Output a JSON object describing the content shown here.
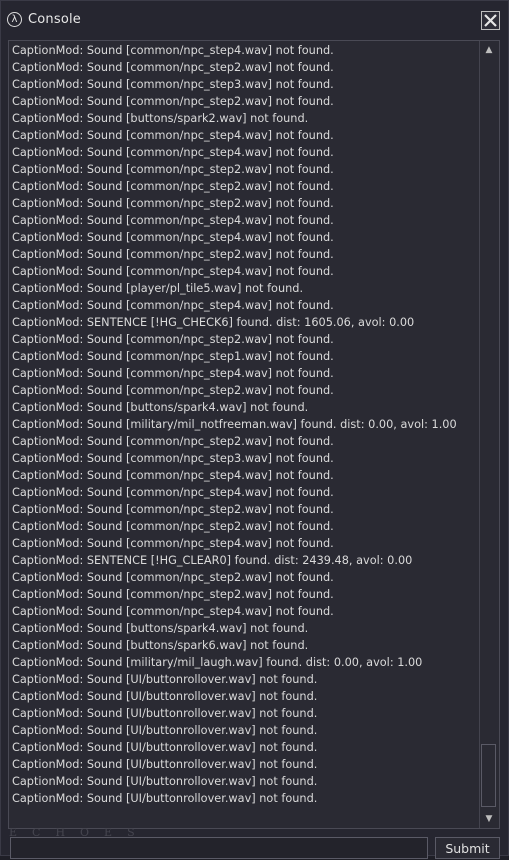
{
  "window": {
    "title": "Console",
    "icon": "lambda-icon",
    "icon_glyph": "λ",
    "close_icon": "close-icon"
  },
  "log": {
    "lines": [
      "CaptionMod: Sound [common/npc_step4.wav] not found.",
      "CaptionMod: Sound [common/npc_step2.wav] not found.",
      "CaptionMod: Sound [common/npc_step3.wav] not found.",
      "CaptionMod: Sound [common/npc_step2.wav] not found.",
      "CaptionMod: Sound [buttons/spark2.wav] not found.",
      "CaptionMod: Sound [common/npc_step4.wav] not found.",
      "CaptionMod: Sound [common/npc_step4.wav] not found.",
      "CaptionMod: Sound [common/npc_step2.wav] not found.",
      "CaptionMod: Sound [common/npc_step2.wav] not found.",
      "CaptionMod: Sound [common/npc_step2.wav] not found.",
      "CaptionMod: Sound [common/npc_step4.wav] not found.",
      "CaptionMod: Sound [common/npc_step4.wav] not found.",
      "CaptionMod: Sound [common/npc_step2.wav] not found.",
      "CaptionMod: Sound [common/npc_step4.wav] not found.",
      "CaptionMod: Sound [player/pl_tile5.wav] not found.",
      "CaptionMod: Sound [common/npc_step4.wav] not found.",
      "CaptionMod: SENTENCE [!HG_CHECK6] found. dist: 1605.06, avol: 0.00",
      "CaptionMod: Sound [common/npc_step2.wav] not found.",
      "CaptionMod: Sound [common/npc_step1.wav] not found.",
      "CaptionMod: Sound [common/npc_step4.wav] not found.",
      "CaptionMod: Sound [common/npc_step2.wav] not found.",
      "CaptionMod: Sound [buttons/spark4.wav] not found.",
      "CaptionMod: Sound [military/mil_notfreeman.wav] found. dist: 0.00, avol: 1.00",
      "CaptionMod: Sound [common/npc_step2.wav] not found.",
      "CaptionMod: Sound [common/npc_step3.wav] not found.",
      "CaptionMod: Sound [common/npc_step4.wav] not found.",
      "CaptionMod: Sound [common/npc_step4.wav] not found.",
      "CaptionMod: Sound [common/npc_step2.wav] not found.",
      "CaptionMod: Sound [common/npc_step2.wav] not found.",
      "CaptionMod: Sound [common/npc_step4.wav] not found.",
      "CaptionMod: SENTENCE [!HG_CLEAR0] found. dist: 2439.48, avol: 0.00",
      "CaptionMod: Sound [common/npc_step2.wav] not found.",
      "CaptionMod: Sound [common/npc_step2.wav] not found.",
      "CaptionMod: Sound [common/npc_step4.wav] not found.",
      "CaptionMod: Sound [buttons/spark4.wav] not found.",
      "CaptionMod: Sound [buttons/spark6.wav] not found.",
      "CaptionMod: Sound [military/mil_laugh.wav] found. dist: 0.00, avol: 1.00",
      "CaptionMod: Sound [UI/buttonrollover.wav] not found.",
      "CaptionMod: Sound [UI/buttonrollover.wav] not found.",
      "CaptionMod: Sound [UI/buttonrollover.wav] not found.",
      "CaptionMod: Sound [UI/buttonrollover.wav] not found.",
      "CaptionMod: Sound [UI/buttonrollover.wav] not found.",
      "CaptionMod: Sound [UI/buttonrollover.wav] not found.",
      "CaptionMod: Sound [UI/buttonrollover.wav] not found.",
      "CaptionMod: Sound [UI/buttonrollover.wav] not found."
    ]
  },
  "scrollbar": {
    "up_icon": "arrow-up-icon",
    "down_icon": "arrow-down-icon",
    "up_glyph": "▲",
    "down_glyph": "▼"
  },
  "watermark": "ECHOES",
  "input": {
    "value": "",
    "placeholder": ""
  },
  "submit_label": "Submit"
}
